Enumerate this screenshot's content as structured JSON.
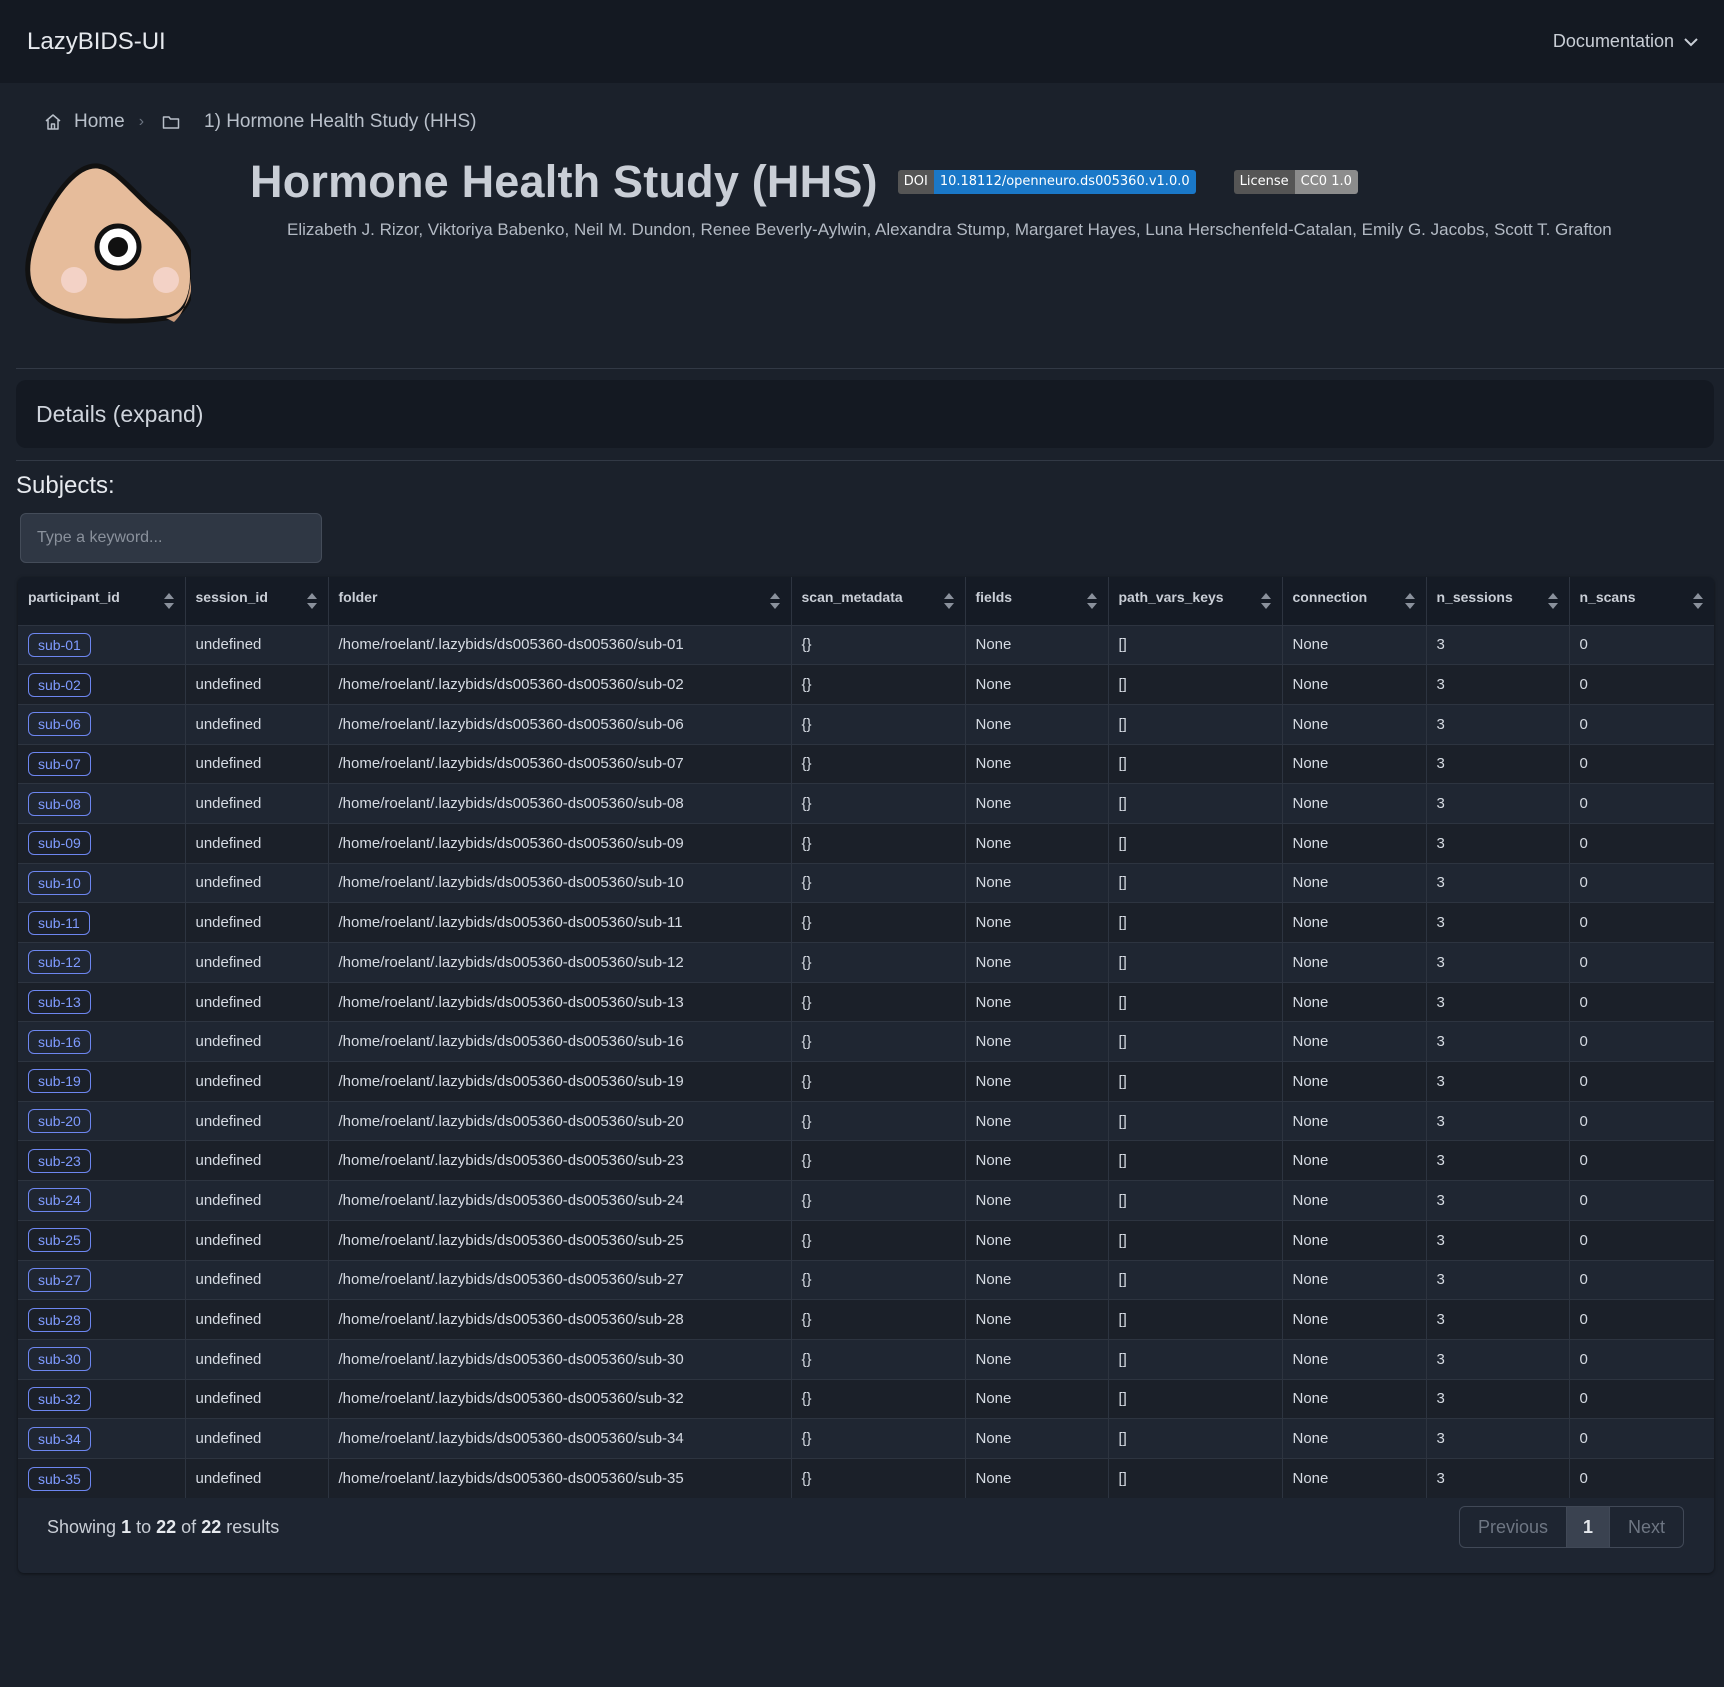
{
  "nav": {
    "brand": "LazyBIDS-UI",
    "documentation": "Documentation"
  },
  "breadcrumb": {
    "home": "Home",
    "current": "1) Hormone Health Study (HHS)"
  },
  "dataset": {
    "title": "Hormone Health Study (HHS)",
    "doi_key": "DOI",
    "doi_value": "10.18112/openneuro.ds005360.v1.0.0",
    "doi_color": "#1a78c8",
    "license_key": "License",
    "license_value": "CC0 1.0",
    "license_color": "#8c8c8c",
    "authors": "Elizabeth J. Rizor, Viktoriya Babenko, Neil M. Dundon, Renee Beverly-Aylwin, Alexandra Stump, Margaret Hayes, Luna Herschenfeld-Catalan, Emily G. Jacobs, Scott T. Grafton"
  },
  "details_label": "Details (expand)",
  "subjects_label": "Subjects:",
  "search": {
    "placeholder": "Type a keyword..."
  },
  "table": {
    "columns": [
      "participant_id",
      "session_id",
      "folder",
      "scan_metadata",
      "fields",
      "path_vars_keys",
      "connection",
      "n_sessions",
      "n_scans"
    ],
    "rows": [
      [
        "sub-01",
        "undefined",
        "/home/roelant/.lazybids/ds005360-ds005360/sub-01",
        "{}",
        "None",
        "[]",
        "None",
        "3",
        "0"
      ],
      [
        "sub-02",
        "undefined",
        "/home/roelant/.lazybids/ds005360-ds005360/sub-02",
        "{}",
        "None",
        "[]",
        "None",
        "3",
        "0"
      ],
      [
        "sub-06",
        "undefined",
        "/home/roelant/.lazybids/ds005360-ds005360/sub-06",
        "{}",
        "None",
        "[]",
        "None",
        "3",
        "0"
      ],
      [
        "sub-07",
        "undefined",
        "/home/roelant/.lazybids/ds005360-ds005360/sub-07",
        "{}",
        "None",
        "[]",
        "None",
        "3",
        "0"
      ],
      [
        "sub-08",
        "undefined",
        "/home/roelant/.lazybids/ds005360-ds005360/sub-08",
        "{}",
        "None",
        "[]",
        "None",
        "3",
        "0"
      ],
      [
        "sub-09",
        "undefined",
        "/home/roelant/.lazybids/ds005360-ds005360/sub-09",
        "{}",
        "None",
        "[]",
        "None",
        "3",
        "0"
      ],
      [
        "sub-10",
        "undefined",
        "/home/roelant/.lazybids/ds005360-ds005360/sub-10",
        "{}",
        "None",
        "[]",
        "None",
        "3",
        "0"
      ],
      [
        "sub-11",
        "undefined",
        "/home/roelant/.lazybids/ds005360-ds005360/sub-11",
        "{}",
        "None",
        "[]",
        "None",
        "3",
        "0"
      ],
      [
        "sub-12",
        "undefined",
        "/home/roelant/.lazybids/ds005360-ds005360/sub-12",
        "{}",
        "None",
        "[]",
        "None",
        "3",
        "0"
      ],
      [
        "sub-13",
        "undefined",
        "/home/roelant/.lazybids/ds005360-ds005360/sub-13",
        "{}",
        "None",
        "[]",
        "None",
        "3",
        "0"
      ],
      [
        "sub-16",
        "undefined",
        "/home/roelant/.lazybids/ds005360-ds005360/sub-16",
        "{}",
        "None",
        "[]",
        "None",
        "3",
        "0"
      ],
      [
        "sub-19",
        "undefined",
        "/home/roelant/.lazybids/ds005360-ds005360/sub-19",
        "{}",
        "None",
        "[]",
        "None",
        "3",
        "0"
      ],
      [
        "sub-20",
        "undefined",
        "/home/roelant/.lazybids/ds005360-ds005360/sub-20",
        "{}",
        "None",
        "[]",
        "None",
        "3",
        "0"
      ],
      [
        "sub-23",
        "undefined",
        "/home/roelant/.lazybids/ds005360-ds005360/sub-23",
        "{}",
        "None",
        "[]",
        "None",
        "3",
        "0"
      ],
      [
        "sub-24",
        "undefined",
        "/home/roelant/.lazybids/ds005360-ds005360/sub-24",
        "{}",
        "None",
        "[]",
        "None",
        "3",
        "0"
      ],
      [
        "sub-25",
        "undefined",
        "/home/roelant/.lazybids/ds005360-ds005360/sub-25",
        "{}",
        "None",
        "[]",
        "None",
        "3",
        "0"
      ],
      [
        "sub-27",
        "undefined",
        "/home/roelant/.lazybids/ds005360-ds005360/sub-27",
        "{}",
        "None",
        "[]",
        "None",
        "3",
        "0"
      ],
      [
        "sub-28",
        "undefined",
        "/home/roelant/.lazybids/ds005360-ds005360/sub-28",
        "{}",
        "None",
        "[]",
        "None",
        "3",
        "0"
      ],
      [
        "sub-30",
        "undefined",
        "/home/roelant/.lazybids/ds005360-ds005360/sub-30",
        "{}",
        "None",
        "[]",
        "None",
        "3",
        "0"
      ],
      [
        "sub-32",
        "undefined",
        "/home/roelant/.lazybids/ds005360-ds005360/sub-32",
        "{}",
        "None",
        "[]",
        "None",
        "3",
        "0"
      ],
      [
        "sub-34",
        "undefined",
        "/home/roelant/.lazybids/ds005360-ds005360/sub-34",
        "{}",
        "None",
        "[]",
        "None",
        "3",
        "0"
      ],
      [
        "sub-35",
        "undefined",
        "/home/roelant/.lazybids/ds005360-ds005360/sub-35",
        "{}",
        "None",
        "[]",
        "None",
        "3",
        "0"
      ]
    ]
  },
  "pagination": {
    "showing_prefix": "Showing",
    "from": "1",
    "to_word": "to",
    "to": "22",
    "of_word": "of",
    "total": "22",
    "results_word": "results",
    "previous": "Previous",
    "current_page": "1",
    "next": "Next"
  },
  "icons": {
    "home": "home-icon",
    "folder": "folder-icon",
    "chevron": "chevron-down-icon",
    "sort": "sort-icon",
    "logo": "lazybids-logo"
  }
}
